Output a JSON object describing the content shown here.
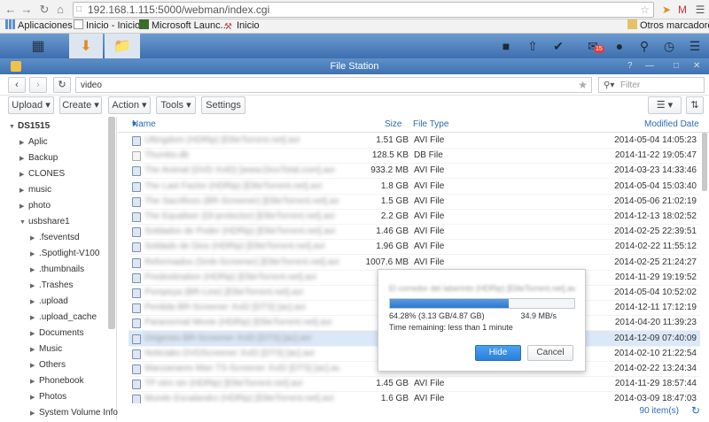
{
  "browser": {
    "url": "192.168.1.115:5000/webman/index.cgi",
    "user_badge": "M"
  },
  "bookmarks": {
    "apps": "Aplicaciones",
    "items": [
      "Inicio - Inicio",
      "Microsoft Launc...",
      "Inicio"
    ],
    "other": "Otros marcadores"
  },
  "dsm": {
    "notification_count": "15"
  },
  "window": {
    "title": "File Station"
  },
  "toolbar": {
    "path": "video",
    "filter_placeholder": "Filter",
    "upload": "Upload",
    "create": "Create",
    "action": "Action",
    "tools": "Tools",
    "settings": "Settings"
  },
  "sidebar": {
    "root": "DS1515",
    "items": [
      {
        "label": "Aplic",
        "level": 1
      },
      {
        "label": "Backup",
        "level": 1
      },
      {
        "label": "CLONES",
        "level": 1
      },
      {
        "label": "music",
        "level": 1
      },
      {
        "label": "photo",
        "level": 1
      },
      {
        "label": "usbshare1",
        "level": 1,
        "expanded": true
      },
      {
        "label": ".fseventsd",
        "level": 2
      },
      {
        "label": ".Spotlight-V100",
        "level": 2
      },
      {
        "label": ".thumbnails",
        "level": 2
      },
      {
        "label": ".Trashes",
        "level": 2
      },
      {
        "label": ".upload",
        "level": 2
      },
      {
        "label": ".upload_cache",
        "level": 2
      },
      {
        "label": "Documents",
        "level": 2
      },
      {
        "label": "Music",
        "level": 2
      },
      {
        "label": "Others",
        "level": 2
      },
      {
        "label": "Phonebook",
        "level": 2
      },
      {
        "label": "Photos",
        "level": 2
      },
      {
        "label": "System Volume Info",
        "level": 2
      }
    ]
  },
  "table": {
    "columns": {
      "name": "Name",
      "size": "Size",
      "type": "File Type",
      "modified": "Modified Date"
    },
    "rows": [
      {
        "name": "Ultingdom (HDRip) [EliteTorrent.net].avi",
        "size": "1.51 GB",
        "type": "AVI File",
        "date": "2014-05-04 14:05:23",
        "icon": "avi"
      },
      {
        "name": "Thumbs.db",
        "size": "128.5 KB",
        "type": "DB File",
        "date": "2014-11-22 19:05:47",
        "icon": "db"
      },
      {
        "name": "The Animal (DVD XviD) [www.DivxTotal.com].avi",
        "size": "933.2 MB",
        "type": "AVI File",
        "date": "2014-03-23 14:33:46",
        "icon": "avi"
      },
      {
        "name": "The Last Factor (HDRip) [EliteTorrent.net].avi",
        "size": "1.8 GB",
        "type": "AVI File",
        "date": "2014-05-04 15:03:40",
        "icon": "avi"
      },
      {
        "name": "The Sacrifices (BR-Screener) [EliteTorrent.net].avi",
        "size": "1.5 GB",
        "type": "AVI File",
        "date": "2014-05-06 21:02:19",
        "icon": "avi"
      },
      {
        "name": "The Equaliser (Dl-protector) [EliteTorrent.net].avi",
        "size": "2.2 GB",
        "type": "AVI File",
        "date": "2014-12-13 18:02:52",
        "icon": "avi"
      },
      {
        "name": "Soldados de Poder (HDRip) [EliteTorrent.net].avi",
        "size": "1.46 GB",
        "type": "AVI File",
        "date": "2014-02-25 22:39:51",
        "icon": "avi"
      },
      {
        "name": "Soldado de Dios (HDRip) [EliteTorrent.net].avi",
        "size": "1.96 GB",
        "type": "AVI File",
        "date": "2014-02-22 11:55:12",
        "icon": "avi"
      },
      {
        "name": "Reformados (Smb-Screener) [EliteTorrent.net].avi",
        "size": "1007.6 MB",
        "type": "AVI File",
        "date": "2014-02-25 21:24:27",
        "icon": "avi"
      },
      {
        "name": "Predestination (HDRip) [EliteTorrent.net].avi",
        "size": "",
        "type": "",
        "date": "2014-11-29 19:19:52",
        "icon": "avi"
      },
      {
        "name": "Pompeya (BR-Line) [EliteTorrent.net].avi",
        "size": "",
        "type": "",
        "date": "2014-05-04 10:52:02",
        "icon": "avi"
      },
      {
        "name": "Perdida BR-Screener XviD [DTS] [ac].avi",
        "size": "",
        "type": "",
        "date": "2014-12-11 17:12:19",
        "icon": "avi"
      },
      {
        "name": "Paranormal Movie (HDRip) [EliteTorrent.net].avi",
        "size": "",
        "type": "",
        "date": "2014-04-20 11:39:23",
        "icon": "avi"
      },
      {
        "name": "Origenes BR-Screener XviD [DTS] [ac].avi",
        "size": "",
        "type": "",
        "date": "2014-12-09 07:40:09",
        "icon": "avi",
        "selected": true
      },
      {
        "name": "Noticiaks DVDScreener XviD [DTS] [ac].avi",
        "size": "",
        "type": "",
        "date": "2014-02-10 21:22:54",
        "icon": "avi"
      },
      {
        "name": "Manzanares Man TS-Screener XviD [DTS] [ac].avi",
        "size": "",
        "type": "",
        "date": "2014-02-22 13:24:34",
        "icon": "avi"
      },
      {
        "name": "TP otro sin (HDRip) [EliteTorrent.net].avi",
        "size": "1.45 GB",
        "type": "AVI File",
        "date": "2014-11-29 18:57:44",
        "icon": "avi"
      },
      {
        "name": "Mundo Escalandro (HDRip) [EliteTorrent.net].avi",
        "size": "1.6 GB",
        "type": "AVI File",
        "date": "2014-03-09 18:47:03",
        "icon": "avi"
      }
    ]
  },
  "footer": {
    "count": "90 item(s)"
  },
  "dialog": {
    "filename": "El corredor del laberinto (HDRip) [EliteTorrent.net].avi",
    "progress": 0.6428,
    "progress_text": "64.28% (3.13 GB/4.87 GB)",
    "speed": "34.9 MB/s",
    "remaining": "Time remaining: less than 1 minute",
    "hide": "Hide",
    "cancel": "Cancel"
  },
  "colors": {
    "accent": "#2b7fd8",
    "header_text": "#2a6ab5",
    "title_bar": "#4a7dbb"
  }
}
